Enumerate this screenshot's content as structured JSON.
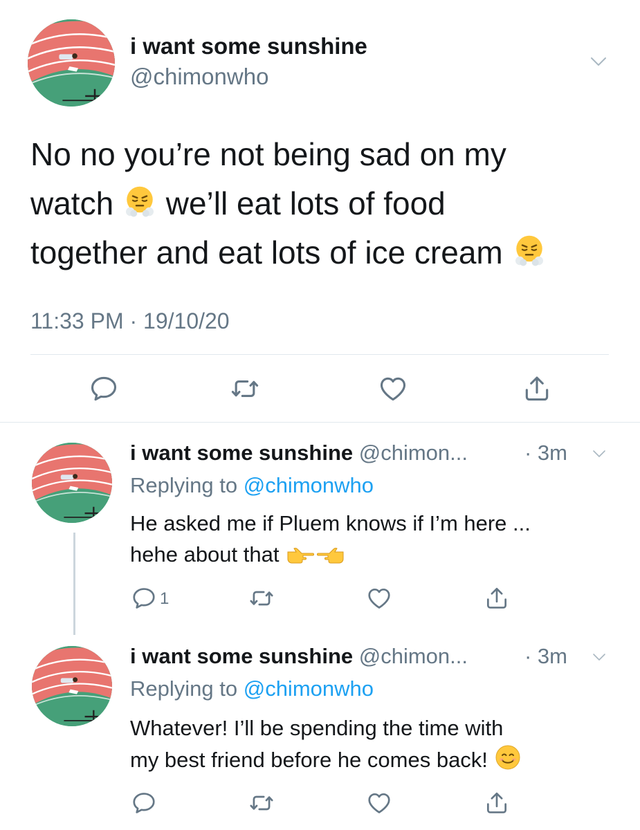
{
  "main_tweet": {
    "display_name": "i want some sunshine",
    "handle": "@chimonwho",
    "text_line1": "No no you’re not being sad on my",
    "text_line2a": "watch",
    "text_line2b": "we’ll eat lots of food",
    "text_line3": "together and eat lots of ice cream",
    "emoji": "face-with-steam-from-nose",
    "timestamp": "11:33 PM · 19/10/20",
    "actions": [
      "reply-icon",
      "retweet-icon",
      "like-icon",
      "share-icon"
    ]
  },
  "replies": [
    {
      "display_name": "i want some sunshine",
      "handle": "@chimon...",
      "time": "· 3m",
      "replying_prefix": "Replying to",
      "replying_to": "@chimonwho",
      "text_line1": "He asked me if Pluem knows if I’m here ...",
      "text_line2": "hehe about that",
      "emoji": [
        "backhand-index-pointing-right",
        "backhand-index-pointing-left"
      ],
      "reply_count": "1",
      "actions": [
        "reply-icon",
        "retweet-icon",
        "like-icon",
        "share-icon"
      ]
    },
    {
      "display_name": "i want some sunshine",
      "handle": "@chimon...",
      "time": "· 3m",
      "replying_prefix": "Replying to",
      "replying_to": "@chimonwho",
      "text_line1": "Whatever! I’ll be spending the time with",
      "text_line2": "my best friend before he comes back!",
      "emoji": [
        "smiling-face-with-smiling-eyes"
      ],
      "actions": [
        "reply-icon",
        "retweet-icon",
        "like-icon",
        "share-icon"
      ]
    }
  ],
  "colors": {
    "text": "#14171a",
    "secondary": "#657786",
    "link": "#1da1f2",
    "divider": "#e1e8ed"
  }
}
